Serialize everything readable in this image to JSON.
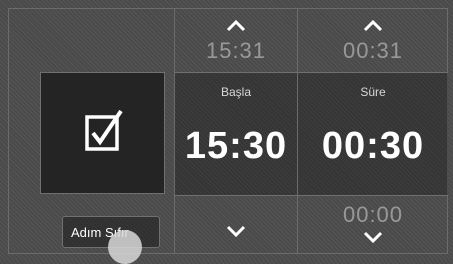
{
  "start": {
    "above_value": "15:31",
    "label": "Başla",
    "value": "15:30"
  },
  "duration": {
    "above_value": "00:31",
    "label": "Süre",
    "value": "00:30",
    "below_value": "00:00"
  },
  "step_button": {
    "label": "Adım Sıfır"
  },
  "icons": {
    "checkbox": "checkbox-checked-icon",
    "up": "chevron-up-icon",
    "down": "chevron-down-icon"
  }
}
